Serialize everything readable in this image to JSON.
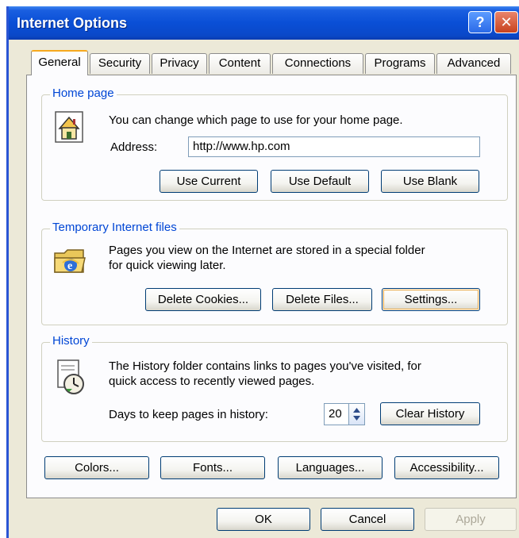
{
  "window": {
    "title": "Internet Options",
    "help_glyph": "?",
    "close_glyph": "✕"
  },
  "tabs": [
    "General",
    "Security",
    "Privacy",
    "Content",
    "Connections",
    "Programs",
    "Advanced"
  ],
  "home_page": {
    "title": "Home page",
    "description": "You can change which page to use for your home page.",
    "address_label": "Address:",
    "address_value": "http://www.hp.com",
    "buttons": {
      "use_current": "Use Current",
      "use_default": "Use Default",
      "use_blank": "Use Blank"
    }
  },
  "temp_files": {
    "title": "Temporary Internet files",
    "line1": "Pages you view on the Internet are stored in a special folder",
    "line2": "for quick viewing later.",
    "buttons": {
      "delete_cookies": "Delete Cookies...",
      "delete_files": "Delete Files...",
      "settings": "Settings..."
    }
  },
  "history": {
    "title": "History",
    "line1": "The History folder contains links to pages you've visited, for",
    "line2": "quick access to recently viewed pages.",
    "days_label": "Days to keep pages in history:",
    "days_value": "20",
    "clear_button": "Clear History"
  },
  "bottom_buttons": {
    "colors": "Colors...",
    "fonts": "Fonts...",
    "languages": "Languages...",
    "accessibility": "Accessibility..."
  },
  "dialog_buttons": {
    "ok": "OK",
    "cancel": "Cancel",
    "apply": "Apply"
  },
  "icons": {
    "home": "home-page-icon",
    "temp_files": "ie-folder-icon",
    "history": "history-clock-icon"
  },
  "colors": {
    "titlebar": "#0a4fd6",
    "accent_tab": "#f7a91f",
    "group_title": "#0046d5",
    "dialog_bg": "#ece9d8"
  }
}
